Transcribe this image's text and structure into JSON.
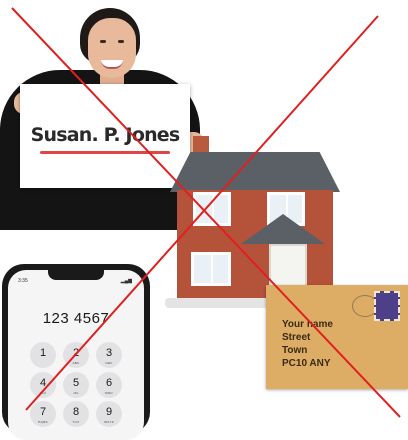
{
  "sign": {
    "name": "Susan. P. Jones"
  },
  "phone": {
    "time": "3:35",
    "number": "123 4567",
    "keys": [
      {
        "digit": "1",
        "letters": ""
      },
      {
        "digit": "2",
        "letters": "ABC"
      },
      {
        "digit": "3",
        "letters": "DEF"
      },
      {
        "digit": "4",
        "letters": "GHI"
      },
      {
        "digit": "5",
        "letters": "JKL"
      },
      {
        "digit": "6",
        "letters": "MNO"
      },
      {
        "digit": "7",
        "letters": "PQRS"
      },
      {
        "digit": "8",
        "letters": "TUV"
      },
      {
        "digit": "9",
        "letters": "WXYZ"
      }
    ]
  },
  "envelope": {
    "line1": "Your name",
    "line2": "Street",
    "line3": "Town",
    "line4": "PC10 ANY"
  },
  "colors": {
    "cross": "#e02020",
    "sign_underline": "#e04545",
    "brick": "#b5523a",
    "envelope": "#ddad66",
    "stamp": "#4d3f88"
  }
}
